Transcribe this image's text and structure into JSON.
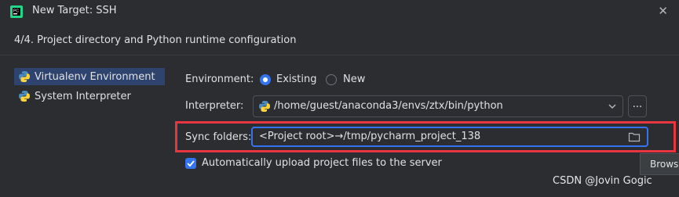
{
  "window": {
    "title": "New Target: SSH",
    "close_icon": "close-icon"
  },
  "step_header": "4/4. Project directory and Python runtime configuration",
  "sidebar": {
    "items": [
      {
        "label": "Virtualenv Environment",
        "icon": "python-icon",
        "selected": true
      },
      {
        "label": "System Interpreter",
        "icon": "python-icon",
        "selected": false
      }
    ]
  },
  "environment": {
    "label": "Environment:",
    "options": [
      {
        "label": "Existing",
        "selected": true
      },
      {
        "label": "New",
        "selected": false
      }
    ]
  },
  "interpreter": {
    "label": "Interpreter:",
    "value": "/home/guest/anaconda3/envs/ztx/bin/python",
    "more_button": "..."
  },
  "sync": {
    "label": "Sync folders:",
    "value": "<Project root>→/tmp/pycharm_project_138"
  },
  "auto_upload": {
    "label": "Automatically upload project files to the server",
    "checked": true
  },
  "tooltip": {
    "browse": "Brows"
  },
  "watermark": "CSDN @Jovin Gogic",
  "colors": {
    "accent": "#3574f0",
    "highlight": "#e8353f",
    "background": "#2b2d30"
  }
}
